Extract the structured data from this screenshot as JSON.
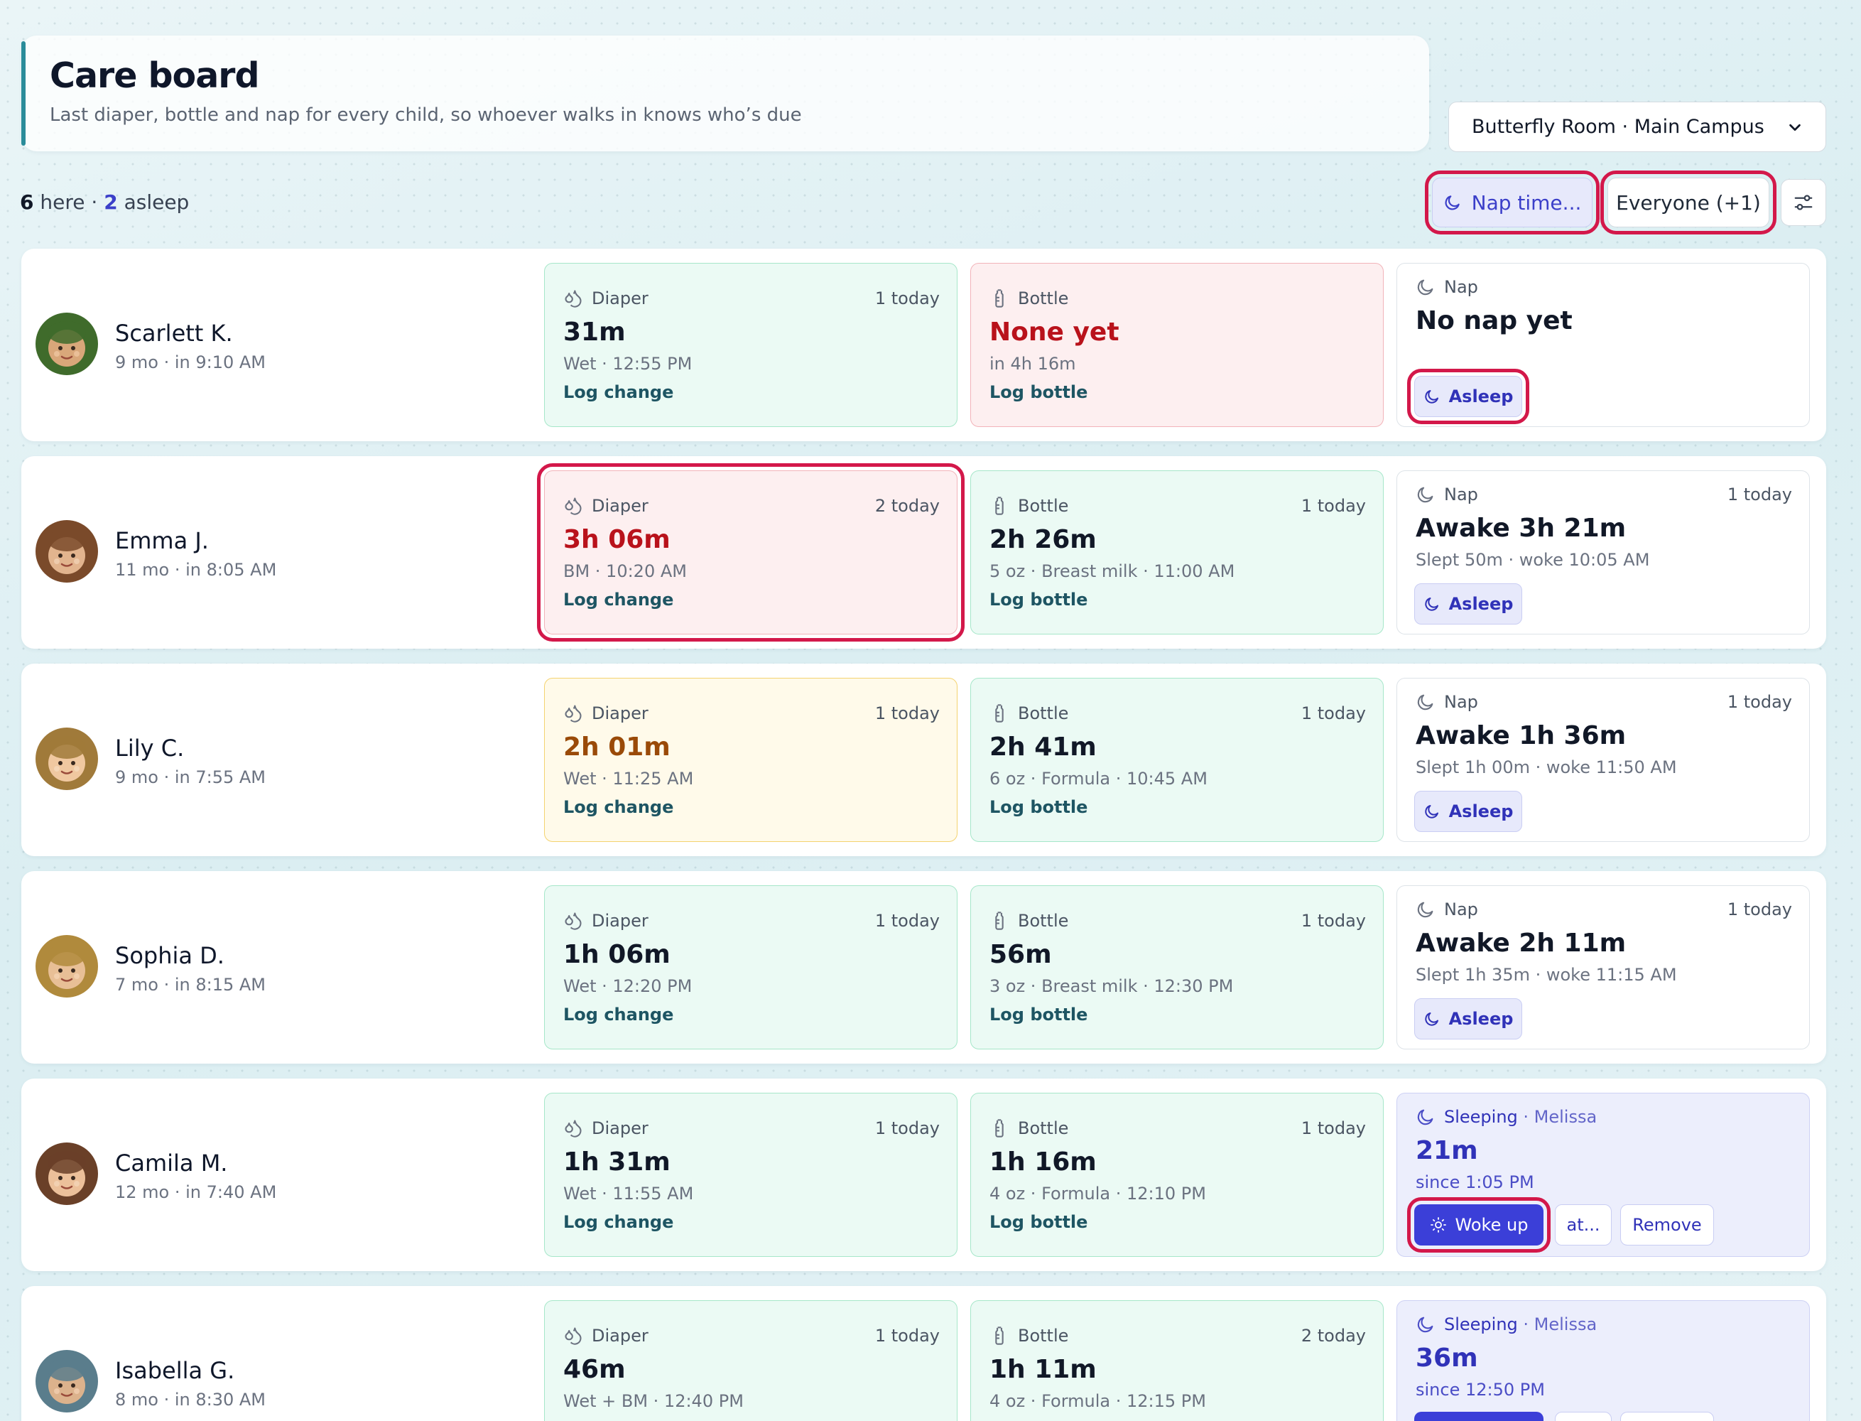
{
  "header": {
    "title": "Care board",
    "subtitle": "Last diaper, bottle and nap for every child, so whoever walks in knows who’s due"
  },
  "room_select": {
    "value": "Butterfly Room · Main Campus"
  },
  "summary": {
    "here_count": "6",
    "here_label": " here · ",
    "asleep_count": "2",
    "asleep_label": " asleep"
  },
  "toolbar": {
    "nap_time_label": "Nap time...",
    "everyone_label": "Everyone (+1)"
  },
  "labels": {
    "diaper": "Diaper",
    "bottle": "Bottle",
    "nap": "Nap",
    "sleeping": "Sleeping",
    "log_change": "Log change",
    "log_bottle": "Log bottle",
    "asleep_button": "Asleep",
    "woke_up_button": "Woke up",
    "at_button": "at...",
    "remove_button": "Remove"
  },
  "rows": [
    {
      "name": "Scarlett K.",
      "meta": "9 mo · in 9:10 AM",
      "diaper": {
        "status": "ok",
        "count": "1 today",
        "main": "31m",
        "detail": "Wet · 12:55 PM"
      },
      "bottle": {
        "status": "bad",
        "count": "",
        "main": "None yet",
        "detail": "in 4h 16m"
      },
      "nap": {
        "state": "none",
        "count": "",
        "main": "No nap yet",
        "detail": ""
      }
    },
    {
      "name": "Emma J.",
      "meta": "11 mo · in 8:05 AM",
      "diaper": {
        "status": "bad",
        "count": "2 today",
        "main": "3h 06m",
        "detail": "BM · 10:20 AM"
      },
      "bottle": {
        "status": "ok",
        "count": "1 today",
        "main": "2h 26m",
        "detail": "5 oz · Breast milk · 11:00 AM"
      },
      "nap": {
        "state": "awake",
        "count": "1 today",
        "main": "Awake 3h 21m",
        "detail": "Slept 50m · woke 10:05 AM"
      }
    },
    {
      "name": "Lily C.",
      "meta": "9 mo · in 7:55 AM",
      "diaper": {
        "status": "warn",
        "count": "1 today",
        "main": "2h 01m",
        "detail": "Wet · 11:25 AM"
      },
      "bottle": {
        "status": "ok",
        "count": "1 today",
        "main": "2h 41m",
        "detail": "6 oz · Formula · 10:45 AM"
      },
      "nap": {
        "state": "awake",
        "count": "1 today",
        "main": "Awake 1h 36m",
        "detail": "Slept 1h 00m · woke 11:50 AM"
      }
    },
    {
      "name": "Sophia D.",
      "meta": "7 mo · in 8:15 AM",
      "diaper": {
        "status": "ok",
        "count": "1 today",
        "main": "1h 06m",
        "detail": "Wet · 12:20 PM"
      },
      "bottle": {
        "status": "ok",
        "count": "1 today",
        "main": "56m",
        "detail": "3 oz · Breast milk · 12:30 PM"
      },
      "nap": {
        "state": "awake",
        "count": "1 today",
        "main": "Awake 2h 11m",
        "detail": "Slept 1h 35m · woke 11:15 AM"
      }
    },
    {
      "name": "Camila M.",
      "meta": "12 mo · in 7:40 AM",
      "diaper": {
        "status": "ok",
        "count": "1 today",
        "main": "1h 31m",
        "detail": "Wet · 11:55 AM"
      },
      "bottle": {
        "status": "ok",
        "count": "1 today",
        "main": "1h 16m",
        "detail": "4 oz · Formula · 12:10 PM"
      },
      "nap": {
        "state": "sleeping",
        "by": " · Melissa",
        "count": "",
        "main": "21m",
        "detail": "since 1:05 PM"
      }
    },
    {
      "name": "Isabella G.",
      "meta": "8 mo · in 8:30 AM",
      "diaper": {
        "status": "ok",
        "count": "1 today",
        "main": "46m",
        "detail": "Wet + BM · 12:40 PM"
      },
      "bottle": {
        "status": "ok",
        "count": "2 today",
        "main": "1h 11m",
        "detail": "4 oz · Formula · 12:15 PM"
      },
      "nap": {
        "state": "sleeping",
        "by": " · Melissa",
        "count": "",
        "main": "36m",
        "detail": "since 12:50 PM"
      }
    }
  ],
  "colors": {
    "accent": "#3b3fd8",
    "ok_bg": "#ebfaf4",
    "ok_border": "#a6e7c9",
    "bad_bg": "#fdeff0",
    "bad_border": "#f2b3b9",
    "warn_bg": "#fffaea",
    "warn_border": "#f4d36f",
    "highlight": "#d3184a"
  },
  "icons": [
    "moon-icon",
    "sliders-icon",
    "droplets-icon",
    "bottle-icon",
    "sun-icon",
    "chevron-down-icon"
  ]
}
